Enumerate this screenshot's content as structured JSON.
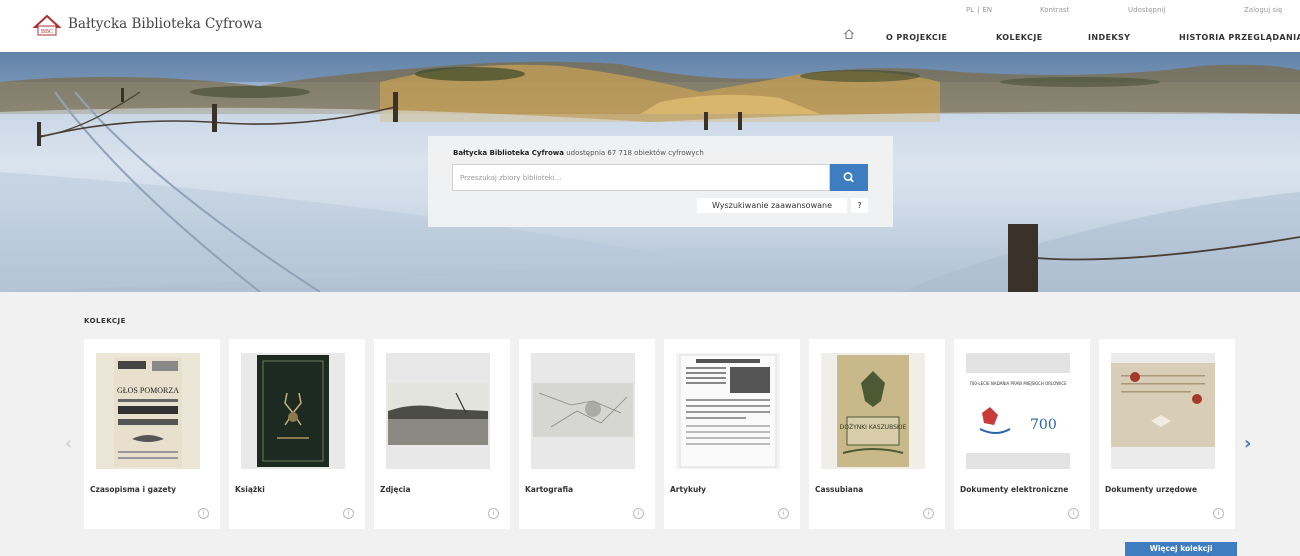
{
  "brand": {
    "name": "Bałtycka Biblioteka Cyfrowa",
    "logo_text": "BBC"
  },
  "topbar": {
    "lang_pl": "PL",
    "lang_en": "EN",
    "contrast": "Kontrast",
    "share": "Udostępnij",
    "login": "Zaloguj się"
  },
  "nav": [
    {
      "label": "O PROJEKCIE"
    },
    {
      "label": "KOLEKCJE"
    },
    {
      "label": "INDEKSY"
    },
    {
      "label": "HISTORIA PRZEGLĄDANIA"
    }
  ],
  "search": {
    "caption_bold": "Bałtycka Biblioteka Cyfrowa",
    "caption_rest": " udostępnia 67 718 obiektów cyfrowych",
    "placeholder": "Przeszukaj zbiory biblioteki...",
    "advanced": "Wyszukiwanie zaawansowane",
    "help": "?"
  },
  "collections": {
    "title": "KOLEKCJE",
    "items": [
      {
        "label": "Czasopisma i gazety",
        "thumb_text": "GŁOS POMORZA"
      },
      {
        "label": "Książki"
      },
      {
        "label": "Zdjęcia"
      },
      {
        "label": "Kartografia"
      },
      {
        "label": "Artykuły"
      },
      {
        "label": "Cassubiana",
        "thumb_text": "DOŻYNKI KASZUBSKIE"
      },
      {
        "label": "Dokumenty elektroniczne",
        "thumb_text": "700-LECIE NADANIA PRAW MIEJSKICH ORLOWICE",
        "thumb_num": "700"
      },
      {
        "label": "Dokumenty urzędowe"
      }
    ],
    "info_icon": "i",
    "more": "Więcej kolekcji"
  },
  "colors": {
    "accent": "#3e7dc0",
    "header_bg": "#ffffff",
    "page_bg": "#f1f1f1"
  }
}
